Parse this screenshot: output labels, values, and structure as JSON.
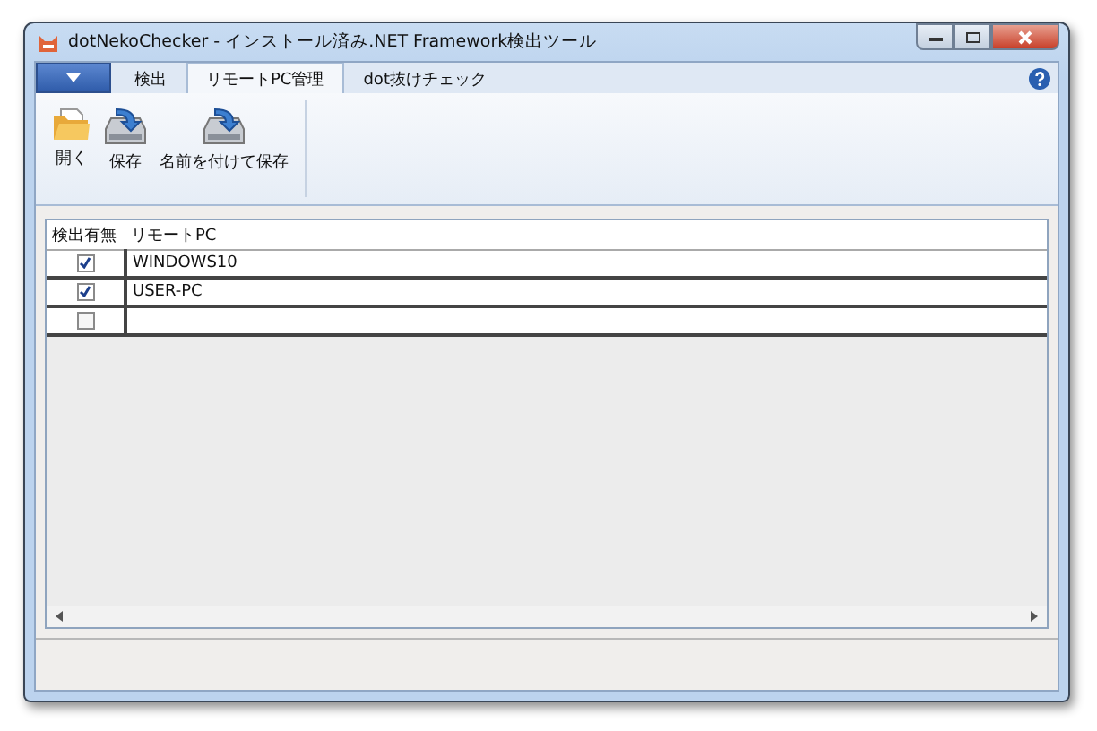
{
  "window": {
    "title": "dotNekoChecker - インストール済み.NET Framework検出ツール"
  },
  "tabs": [
    {
      "label": "検出",
      "selected": false
    },
    {
      "label": "リモートPC管理",
      "selected": true
    },
    {
      "label": "dot抜けチェック",
      "selected": false
    }
  ],
  "ribbon": [
    {
      "label": "開く",
      "kind": "open"
    },
    {
      "label": "保存",
      "kind": "save"
    },
    {
      "label": "名前を付けて保存",
      "kind": "saveas"
    }
  ],
  "table": {
    "columns": [
      "検出有無",
      "リモートPC"
    ],
    "rows": [
      {
        "checked": true,
        "pc": "WINDOWS10"
      },
      {
        "checked": true,
        "pc": "USER-PC"
      },
      {
        "checked": false
      }
    ]
  }
}
